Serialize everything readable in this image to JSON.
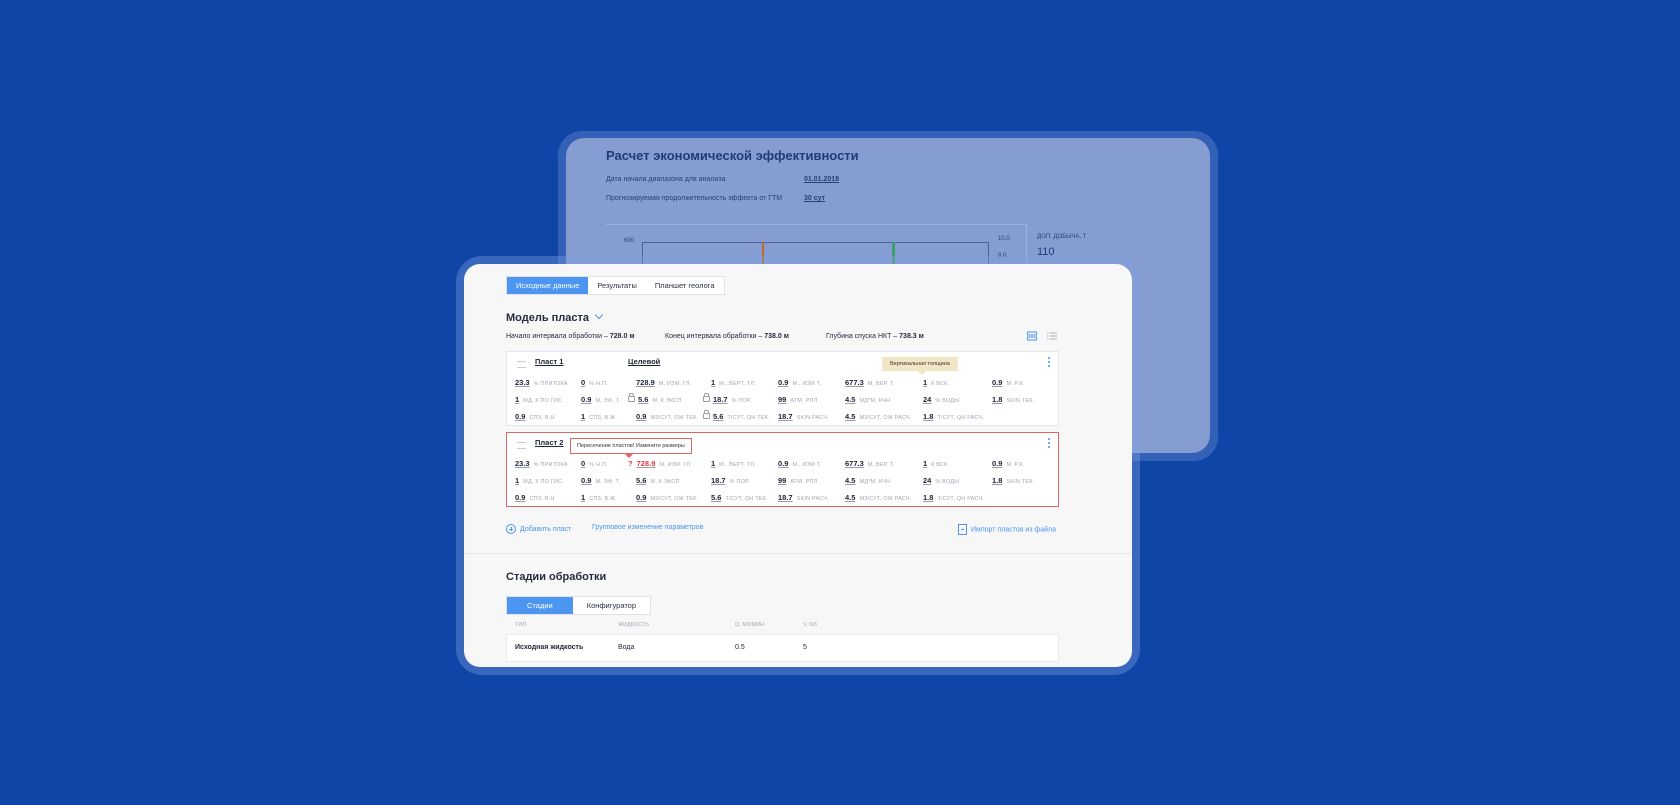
{
  "back": {
    "title": "Расчет экономической эффективности",
    "rows": [
      {
        "label": "Дата начала диапазона для анализа",
        "value": "01.01.2018"
      },
      {
        "label": "Прогнозируемая продолжительность эффекта от ГТМ",
        "value": "30 сут"
      }
    ],
    "axis_left_top": "600",
    "axis_right_top": "10.0",
    "axis_right_second": "8.0",
    "side_label": "ДОП. ДОБЫЧА, Т",
    "side_value": "110"
  },
  "tabs": [
    "Исходные данные",
    "Результаты",
    "Планшет геолога"
  ],
  "model_title": "Модель пласта",
  "meta": [
    {
      "label": "Начало интервала обработки – ",
      "value": "728.0 м"
    },
    {
      "label": "Конец интервала обработки – ",
      "value": "738.0 м"
    },
    {
      "label": "Глубина спуска НКТ – ",
      "value": "738.3 м"
    }
  ],
  "layers": [
    {
      "name": "Пласт 1",
      "tag": "Целевой",
      "tooltip": "Вертикальная толщина",
      "rows": [
        [
          {
            "n": "23.3",
            "u": "% ПРИТОКА"
          },
          {
            "n": "0",
            "u": "% Н.П."
          },
          {
            "n": "728.9",
            "u": "М, ИЗМ. ГЛ."
          },
          {
            "n": "1",
            "u": "М., ВЕРТ. ТЛ."
          },
          {
            "n": "0.9",
            "u": "М., ИЗМ Т."
          },
          {
            "n": "677.3",
            "u": "М, ВЕР. Т."
          },
          {
            "n": "1",
            "u": "К ВСК."
          },
          {
            "n": "0.9",
            "u": "М. Р.К."
          }
        ],
        [
          {
            "n": "1",
            "u": "МД, К ПО ГИС"
          },
          {
            "n": "0.9",
            "u": "М, ЭФ. Т."
          },
          {
            "n": "5.6",
            "u": "М, К ЭКСП"
          },
          {
            "n": "18.7",
            "u": "% ПОР."
          },
          {
            "n": "99",
            "u": "АТМ, РПЛ"
          },
          {
            "n": "4.5",
            "u": "МД*М, КЧН"
          },
          {
            "n": "24",
            "u": "% ВОДЫ"
          },
          {
            "n": "1.8",
            "u": "SKIN ТЕК."
          }
        ],
        [
          {
            "n": "0.9",
            "u": "СПЗ, В.Н"
          },
          {
            "n": "1",
            "u": "СПЗ, В.Ж."
          },
          {
            "n": "0.9",
            "u": "М3/СУТ, ОЖ ТЕК."
          },
          {
            "n": "5.6",
            "u": "Т/СУТ, QН ТЕК."
          },
          {
            "n": "18.7",
            "u": "SKIN РАСЧ."
          },
          {
            "n": "4.5",
            "u": "М3/СУТ, ОЖ РАСЧ."
          },
          {
            "n": "1.8",
            "u": "Т/СУТ, QН РАСЧ."
          }
        ]
      ]
    },
    {
      "name": "Пласт 2",
      "tooltip": "Пересечение пластов! Измените размеры",
      "rows": [
        [
          {
            "n": "23.3",
            "u": "% ПРИТОКА"
          },
          {
            "n": "0",
            "u": "% Н.П."
          },
          {
            "n": "728.9",
            "u": "М, ИЗМ. ГЛ.",
            "q": "?"
          },
          {
            "n": "1",
            "u": "М., ВЕРТ. ТЛ."
          },
          {
            "n": "0.9",
            "u": "М., ИЗМ Т."
          },
          {
            "n": "677.3",
            "u": "М, ВЕР. Т."
          },
          {
            "n": "1",
            "u": "К ВСК."
          },
          {
            "n": "0.9",
            "u": "М. Р.К."
          }
        ],
        [
          {
            "n": "1",
            "u": "МД, К ПО ГИС"
          },
          {
            "n": "0.9",
            "u": "М, ЭФ. Т."
          },
          {
            "n": "5.6",
            "u": "М, К ЭКСП"
          },
          {
            "n": "18.7",
            "u": "% ПОР."
          },
          {
            "n": "99",
            "u": "АТМ, РПЛ"
          },
          {
            "n": "4.5",
            "u": "МД*М, КЧН"
          },
          {
            "n": "24",
            "u": "% ВОДЫ"
          },
          {
            "n": "1.8",
            "u": "SKIN ТЕК."
          }
        ],
        [
          {
            "n": "0.9",
            "u": "СПЗ, В.Н"
          },
          {
            "n": "1",
            "u": "СПЗ, В.Ж."
          },
          {
            "n": "0.9",
            "u": "М3/СУТ, ОЖ ТЕК."
          },
          {
            "n": "5.6",
            "u": "Т/СУТ, QН ТЕК."
          },
          {
            "n": "18.7",
            "u": "SKIN РАСЧ."
          },
          {
            "n": "4.5",
            "u": "М3/СУТ, ОЖ РАСЧ."
          },
          {
            "n": "1.8",
            "u": "Т/СУТ, QН РАСЧ."
          }
        ]
      ]
    }
  ],
  "links": {
    "add": "Добавить пласт",
    "group": "Групповое изменение параметров",
    "import": "Импорт пластов из файла"
  },
  "stages_title": "Стадии обработки",
  "stage_tabs": [
    "Стадии",
    "Конфигуратор"
  ],
  "table": {
    "headers": [
      "ТИП",
      "ЖИДКОСТЬ",
      "Q, М3/МИН",
      "V, М3"
    ],
    "row": [
      "Исходная жидкость",
      "Вода",
      "0.5",
      "5"
    ]
  },
  "colors": {
    "accent": "#4c95f0",
    "error": "#e23b3b",
    "background": "#1045a8"
  }
}
